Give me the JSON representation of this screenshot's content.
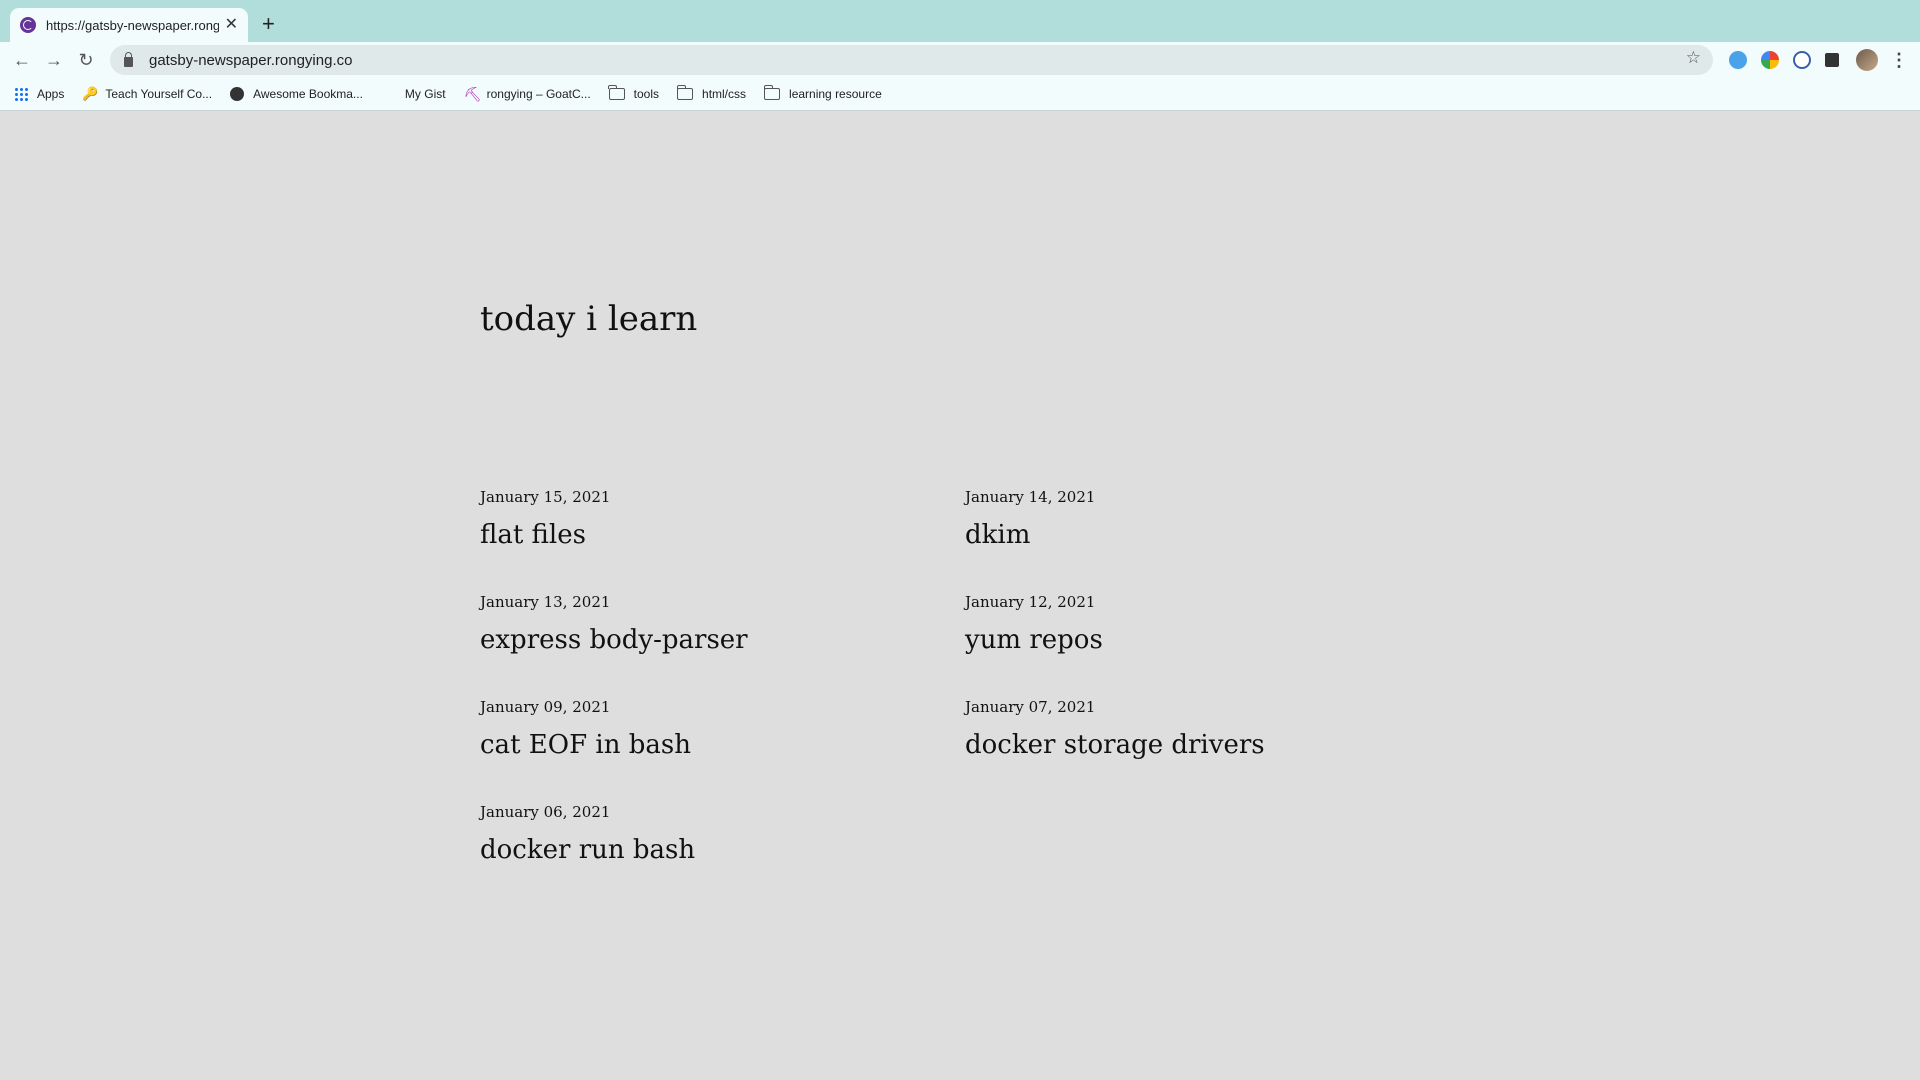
{
  "browser": {
    "tab": {
      "title": "https://gatsby-newspaper.rongying.co"
    },
    "url": "gatsby-newspaper.rongying.co",
    "bookmarks": [
      {
        "label": "Apps",
        "icon": "apps-icon"
      },
      {
        "label": "Teach Yourself Co...",
        "icon": "key-icon"
      },
      {
        "label": "Awesome Bookma...",
        "icon": "globe-icon"
      },
      {
        "label": "My Gist",
        "icon": ""
      },
      {
        "label": "rongying – GoatC...",
        "icon": "pickaxe-icon"
      },
      {
        "label": "tools",
        "icon": "folder-icon"
      },
      {
        "label": "html/css",
        "icon": "folder-icon"
      },
      {
        "label": "learning resource",
        "icon": "folder-icon"
      }
    ]
  },
  "site": {
    "title": "today i learn",
    "posts": [
      {
        "date": "January 15, 2021",
        "title": "flat files"
      },
      {
        "date": "January 14, 2021",
        "title": "dkim"
      },
      {
        "date": "January 13, 2021",
        "title": "express body-parser"
      },
      {
        "date": "January 12, 2021",
        "title": "yum repos"
      },
      {
        "date": "January 09, 2021",
        "title": "cat EOF in bash"
      },
      {
        "date": "January 07, 2021",
        "title": "docker storage drivers"
      },
      {
        "date": "January 06, 2021",
        "title": "docker run bash"
      }
    ]
  }
}
